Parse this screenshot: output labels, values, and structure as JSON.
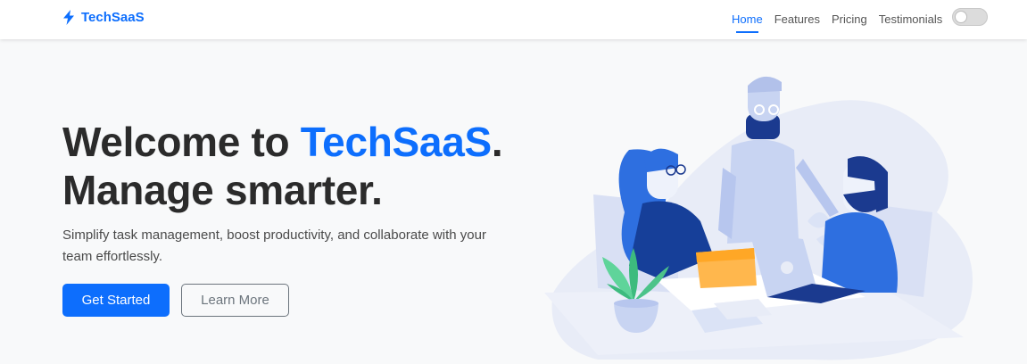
{
  "nav": {
    "brand": "TechSaaS",
    "links": [
      {
        "label": "Home",
        "active": true
      },
      {
        "label": "Features",
        "active": false
      },
      {
        "label": "Pricing",
        "active": false
      },
      {
        "label": "Testimonials",
        "active": false
      }
    ],
    "theme_toggle_on": false
  },
  "hero": {
    "title_prefix": "Welcome to ",
    "title_accent": "TechSaaS",
    "title_suffix": ".",
    "title_line2": "Manage smarter.",
    "subtitle": "Simplify task management, boost productivity, and collaborate with your team effortlessly.",
    "cta_primary": "Get Started",
    "cta_secondary": "Learn More"
  },
  "colors": {
    "accent": "#0d6efd",
    "illustration_blue": "#2e6fe0",
    "illustration_yellow": "#ffb74d",
    "plant_green": "#4cc38a"
  },
  "icons": {
    "brand_icon": "lightning-bolt-icon"
  }
}
